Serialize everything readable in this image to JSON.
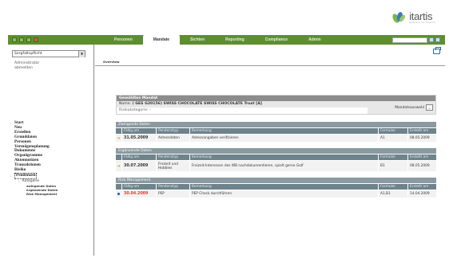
{
  "logo": {
    "text": "itartis",
    "sub": "partners for finance"
  },
  "nav": {
    "tabs": [
      "Personen",
      "Mandate",
      "Sichten",
      "Reporting",
      "Compliance",
      "Admin"
    ],
    "active_index": 1,
    "search_placeholder": ""
  },
  "sidebar": {
    "dropdown_value": "Sorgfaltspflicht",
    "dropdown_arrow": "▼",
    "user": "Administrator",
    "logout": "abmelden",
    "menu": [
      {
        "label": "Start",
        "bullet": "›"
      },
      {
        "label": "Neu",
        "bullet": ""
      },
      {
        "label": "Erstellen",
        "bullet": ""
      },
      {
        "label": "Grunddaten",
        "bullet": ""
      },
      {
        "label": "Personen",
        "bullet": ""
      },
      {
        "label": "Vermögensplanung",
        "bullet": ""
      },
      {
        "label": "Dokumente",
        "bullet": ""
      },
      {
        "label": "Organigramme",
        "bullet": ""
      },
      {
        "label": "Aktennotizen",
        "bullet": ""
      },
      {
        "label": "Transaktionen",
        "bullet": ""
      },
      {
        "label": "Risiko",
        "bullet": ""
      },
      {
        "label": "Pendenzen",
        "bullet": "›"
      }
    ],
    "sub_label": "Kategorie",
    "sub_bullet": "›",
    "sub_items": [
      "zwingende Daten",
      "ergänzende Daten",
      "Risk Management"
    ]
  },
  "main": {
    "page_label": "Overview",
    "mandat": {
      "title": "Gewähltes Mandat",
      "name_label": "Name:",
      "name_value": "( GES G20156) SWISS CHOCOLATE SWISS CHOCOLATE Trust [A]",
      "risk_label": "Risikokategorie:",
      "risk_value": "-",
      "button_label": "Mandatsauswahl",
      "button_glyph": "..."
    },
    "columns": [
      "Fällig am",
      "Pendenztyp",
      "Bemerkung",
      "Formular",
      "Erstellt am"
    ],
    "sections": [
      {
        "title": "Zwingende Daten",
        "rows": [
          {
            "marker": "arrow",
            "date": "31.05.2009",
            "type": "Adressdaten",
            "remark": "Adressangaben verifizieren",
            "form": "A1",
            "created": "08.05.2009",
            "red": false
          }
        ]
      },
      {
        "title": "Ergänzende Daten",
        "rows": [
          {
            "marker": "arrow",
            "date": "30.07.2009",
            "type": "Freizeit und Hobbies",
            "remark": "Freizeit-Interessen des WB nachdokumentieren, spielt gerne Golf",
            "form": "B1",
            "created": "08.05.2009",
            "red": false
          }
        ]
      },
      {
        "title": "Risk Management",
        "rows": [
          {
            "marker": "dot",
            "date": "30.04.2009",
            "type": "PEP",
            "remark": "PEP Check durchführen",
            "form": "A1,B1",
            "created": "14.04.2009",
            "red": true
          }
        ]
      }
    ]
  },
  "colors": {
    "nav_green": "#5e8f2e",
    "section_header": "#8a9aa0",
    "column_header": "#6e838b",
    "overdue_red": "#e23a2a",
    "logo_green": "#7ab648",
    "logo_blue": "#3a7bbf"
  },
  "icons": [
    "home-icon",
    "folder-icon",
    "mail-icon",
    "close-icon",
    "search-icon",
    "print-icon",
    "arrow-right-icon",
    "bullet-dot-icon"
  ]
}
